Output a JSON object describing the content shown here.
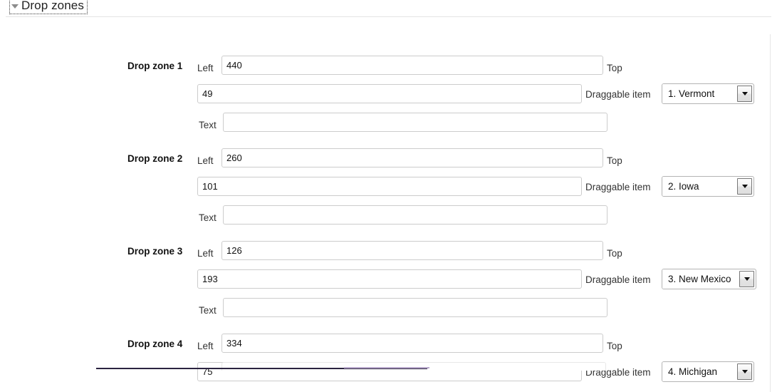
{
  "panel": {
    "title": "Drop zones",
    "caret_icon": "triangle-down-icon"
  },
  "labels": {
    "left": "Left",
    "top": "Top",
    "text": "Text",
    "draggable_item": "Draggable item"
  },
  "zones": [
    {
      "title": "Drop zone 1",
      "left_value": "440",
      "top_value": "49",
      "text_value": "",
      "text_placeholder": "",
      "draggable_item": "1. Vermont"
    },
    {
      "title": "Drop zone 2",
      "left_value": "260",
      "top_value": "101",
      "text_value": "",
      "text_placeholder": "",
      "draggable_item": "2. Iowa"
    },
    {
      "title": "Drop zone 3",
      "left_value": "126",
      "top_value": "193",
      "text_value": "",
      "text_placeholder": "",
      "draggable_item": "3. New Mexico"
    },
    {
      "title": "Drop zone 4",
      "left_value": "334",
      "top_value": "75",
      "text_value": "",
      "text_placeholder": "",
      "draggable_item": "4. Michigan"
    }
  ],
  "colors": {
    "field_border": "#cccccc",
    "combo_border": "#b4b4b4",
    "divider": "#e3e3e3",
    "text": "#111111"
  }
}
